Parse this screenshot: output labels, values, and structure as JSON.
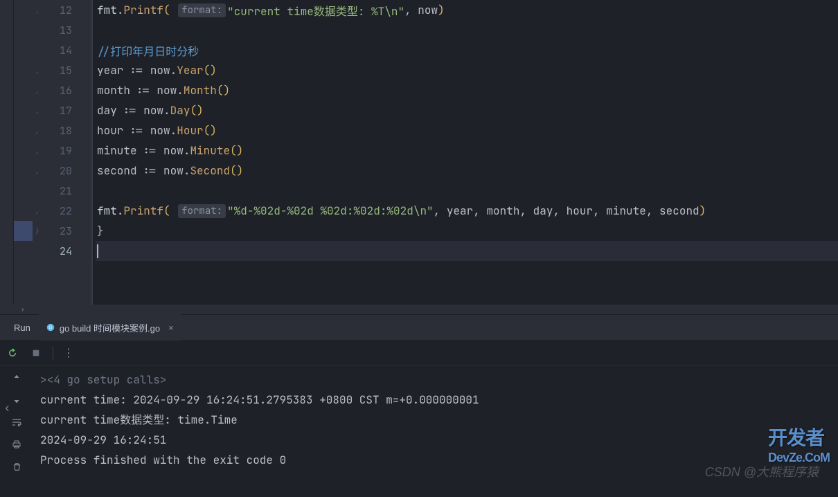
{
  "editor": {
    "lines": [
      {
        "num": "12",
        "fold": ","
      },
      {
        "num": "13",
        "fold": ""
      },
      {
        "num": "14",
        "fold": ""
      },
      {
        "num": "15",
        "fold": ","
      },
      {
        "num": "16",
        "fold": ","
      },
      {
        "num": "17",
        "fold": ","
      },
      {
        "num": "18",
        "fold": ","
      },
      {
        "num": "19",
        "fold": ","
      },
      {
        "num": "20",
        "fold": ","
      },
      {
        "num": "21",
        "fold": ""
      },
      {
        "num": "22",
        "fold": ","
      },
      {
        "num": "23",
        "fold": "}"
      },
      {
        "num": "24",
        "fold": ""
      }
    ],
    "code": {
      "l12_fmt": "fmt",
      "l12_dot": ".",
      "l12_printf": "Printf",
      "l12_hint": "format:",
      "l12_str": "\"current time数据类型: %T\\n\"",
      "l12_comma": ",",
      "l12_now": " now",
      "l14_comment": "//打印年月日时分秒",
      "l15_var": "year ",
      "l15_op": ":= ",
      "l15_now": "now",
      "l15_dot": ".",
      "l15_call": "Year",
      "l15_paren": "()",
      "l16_var": "month ",
      "l16_op": ":= ",
      "l16_now": "now",
      "l16_dot": ".",
      "l16_call": "Month",
      "l16_paren": "()",
      "l17_var": "day ",
      "l17_op": ":= ",
      "l17_now": "now",
      "l17_dot": ".",
      "l17_call": "Day",
      "l17_paren": "()",
      "l18_var": "hour ",
      "l18_op": ":= ",
      "l18_now": "now",
      "l18_dot": ".",
      "l18_call": "Hour",
      "l18_paren": "()",
      "l19_var": "minute ",
      "l19_op": ":= ",
      "l19_now": "now",
      "l19_dot": ".",
      "l19_call": "Minute",
      "l19_paren": "()",
      "l20_var": "second ",
      "l20_op": ":= ",
      "l20_now": "now",
      "l20_dot": ".",
      "l20_call": "Second",
      "l20_paren": "()",
      "l22_fmt": "fmt",
      "l22_dot": ".",
      "l22_printf": "Printf",
      "l22_hint": "format:",
      "l22_str": "\"%d-%02d-%02d %02d:%02d:%02d\\n\"",
      "l22_args": ", year, month, day, hour, minute, second",
      "l23_brace": "}"
    }
  },
  "run_panel": {
    "label": "Run",
    "tab_label": "go build 时间模块案例.go",
    "close": "×"
  },
  "console": {
    "setup": "<4 go setup calls>",
    "line1": "current time: 2024-09-29 16:24:51.2795383 +0800 CST m=+0.000000001",
    "line2": "current time数据类型: time.Time",
    "line3": "2024-09-29 16:24:51",
    "line4": "",
    "line5": "Process finished with the exit code 0"
  },
  "watermark": {
    "devze_main": "开发者",
    "devze_sub": "DevZe.CoM",
    "csdn": "CSDN @大熊程序猿"
  }
}
